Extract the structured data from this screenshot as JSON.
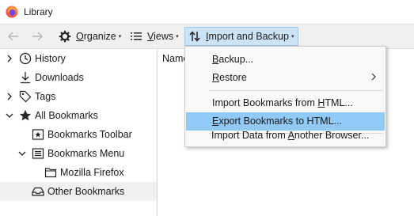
{
  "window": {
    "title": "Library"
  },
  "toolbar": {
    "organize_label": "Organize",
    "organize_mnemonic": "O",
    "organize_rest": "rganize",
    "views_label": "Views",
    "views_mnemonic": "V",
    "views_rest": "iews",
    "import_label": "Import and Backup",
    "import_mnemonic": "I",
    "import_rest": "mport and Backup"
  },
  "sidebar": {
    "items": [
      {
        "label": "History",
        "icon": "clock-icon"
      },
      {
        "label": "Downloads",
        "icon": "download-icon"
      },
      {
        "label": "Tags",
        "icon": "tag-icon"
      },
      {
        "label": "All Bookmarks",
        "icon": "star-icon"
      },
      {
        "label": "Bookmarks Toolbar",
        "icon": "toolbar-icon"
      },
      {
        "label": "Bookmarks Menu",
        "icon": "menu-icon"
      },
      {
        "label": "Mozilla Firefox",
        "icon": "folder-icon"
      },
      {
        "label": "Other Bookmarks",
        "icon": "tray-icon"
      }
    ]
  },
  "content": {
    "column_name": "Name"
  },
  "menu": {
    "items": [
      {
        "m": "B",
        "rest": "ackup..."
      },
      {
        "m": "R",
        "rest": "estore"
      },
      {
        "m": "",
        "pre": "Import Bookmarks from ",
        "mm": "H",
        "post": "TML..."
      },
      {
        "m": "E",
        "rest": "xport Bookmarks to HTML..."
      },
      {
        "m": "",
        "pre": "Import Data from ",
        "mm": "A",
        "post": "nother Browser..."
      }
    ]
  },
  "colors": {
    "accent": "#91c9f7",
    "button_active": "#cde4f7",
    "toolbar_bg": "#f0f0f0"
  }
}
